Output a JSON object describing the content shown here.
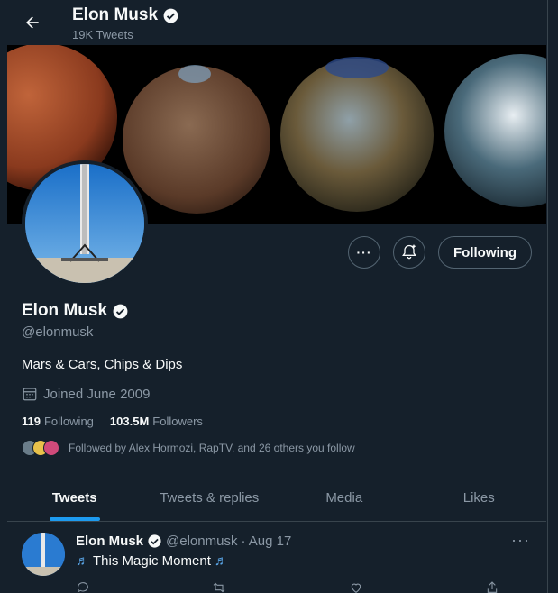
{
  "header": {
    "name": "Elon Musk",
    "tweet_count": "19K Tweets"
  },
  "profile": {
    "name": "Elon Musk",
    "handle": "@elonmusk",
    "bio": "Mars & Cars, Chips & Dips",
    "joined": "Joined June 2009",
    "following_count": "119",
    "following_label": "Following",
    "followers_count": "103.5M",
    "followers_label": "Followers",
    "followed_by": "Followed by Alex Hormozi, RapTV, and 26 others you follow"
  },
  "buttons": {
    "more": "···",
    "following": "Following"
  },
  "tabs": [
    {
      "label": "Tweets",
      "active": true
    },
    {
      "label": "Tweets & replies",
      "active": false
    },
    {
      "label": "Media",
      "active": false
    },
    {
      "label": "Likes",
      "active": false
    }
  ],
  "tweet": {
    "name": "Elon Musk",
    "handle": "@elonmusk",
    "date": "· Aug 17",
    "text": "This Magic Moment",
    "more": "···",
    "replies": "",
    "retweets": "",
    "likes": ""
  },
  "colors": {
    "background": "#15202b",
    "accent": "#1d9bf0",
    "muted": "#8b98a5",
    "border": "#38444d"
  },
  "icons": [
    "back-arrow-icon",
    "verified-badge-icon",
    "more-icon",
    "notification-bell-icon",
    "calendar-icon",
    "music-note-icon",
    "reply-icon",
    "retweet-icon",
    "like-icon",
    "share-icon"
  ]
}
